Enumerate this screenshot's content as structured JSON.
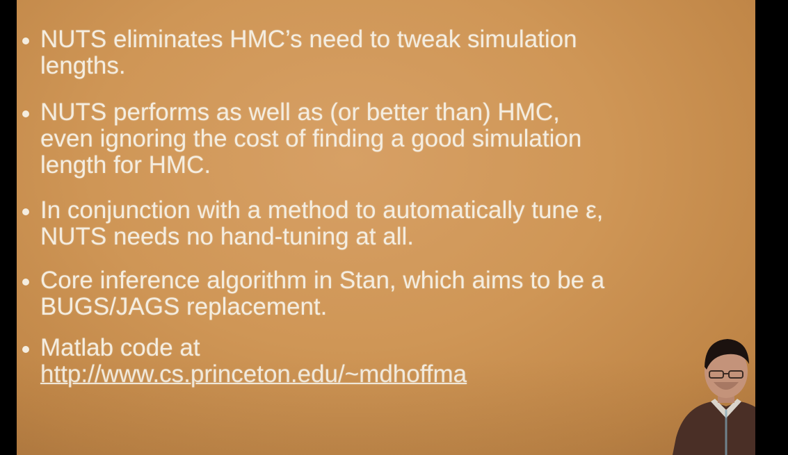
{
  "slide": {
    "bullets": [
      {
        "text": "NUTS eliminates HMC’s need to tweak simulation\nlengths."
      },
      {
        "text": "NUTS performs as well as (or better than) HMC,\neven ignoring the cost of finding a good simulation\nlength for HMC."
      },
      {
        "text": "In conjunction with a method to automatically tune ε,\nNUTS needs no hand-tuning at all."
      },
      {
        "text": "Core inference algorithm in Stan, which aims to be a\nBUGS/JAGS replacement."
      },
      {
        "text": "Matlab code at",
        "link": "http://www.cs.princeton.edu/~mdhoffma"
      }
    ]
  },
  "colors": {
    "background": "#cf9656",
    "text": "#f4ede0",
    "frame": "#000000"
  }
}
